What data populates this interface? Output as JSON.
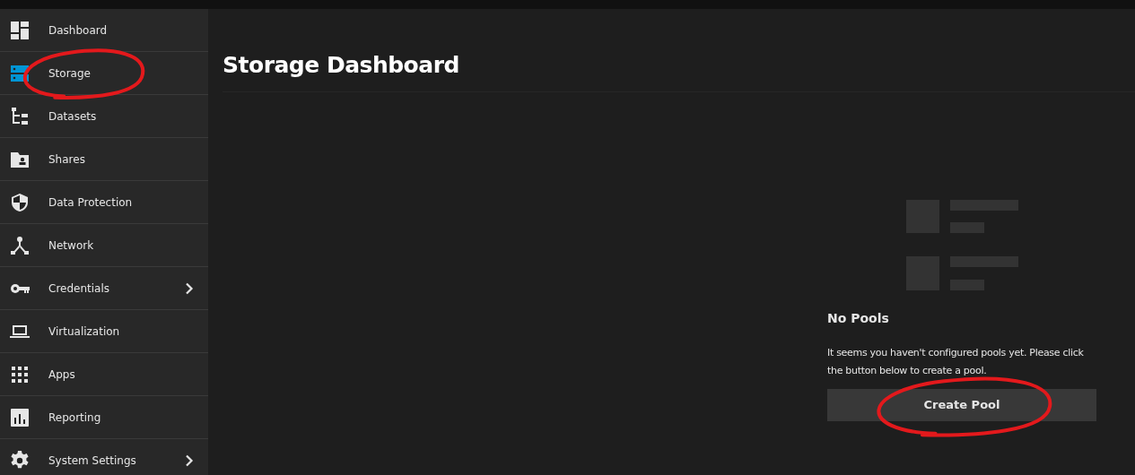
{
  "sidebar": {
    "items": [
      {
        "label": "Dashboard",
        "selected": false,
        "submenu": false
      },
      {
        "label": "Storage",
        "selected": true,
        "submenu": false
      },
      {
        "label": "Datasets",
        "selected": false,
        "submenu": false
      },
      {
        "label": "Shares",
        "selected": false,
        "submenu": false
      },
      {
        "label": "Data Protection",
        "selected": false,
        "submenu": false
      },
      {
        "label": "Network",
        "selected": false,
        "submenu": false
      },
      {
        "label": "Credentials",
        "selected": false,
        "submenu": true
      },
      {
        "label": "Virtualization",
        "selected": false,
        "submenu": false
      },
      {
        "label": "Apps",
        "selected": false,
        "submenu": false
      },
      {
        "label": "Reporting",
        "selected": false,
        "submenu": false
      },
      {
        "label": "System Settings",
        "selected": false,
        "submenu": true
      }
    ]
  },
  "page": {
    "title": "Storage Dashboard"
  },
  "empty_state": {
    "title": "No Pools",
    "message": "It seems you haven't configured pools yet. Please click the button below to create a pool.",
    "button": "Create Pool"
  },
  "annotations": [
    {
      "kind": "circle",
      "color": "#e3191c"
    },
    {
      "kind": "circle",
      "color": "#e3191c"
    }
  ]
}
